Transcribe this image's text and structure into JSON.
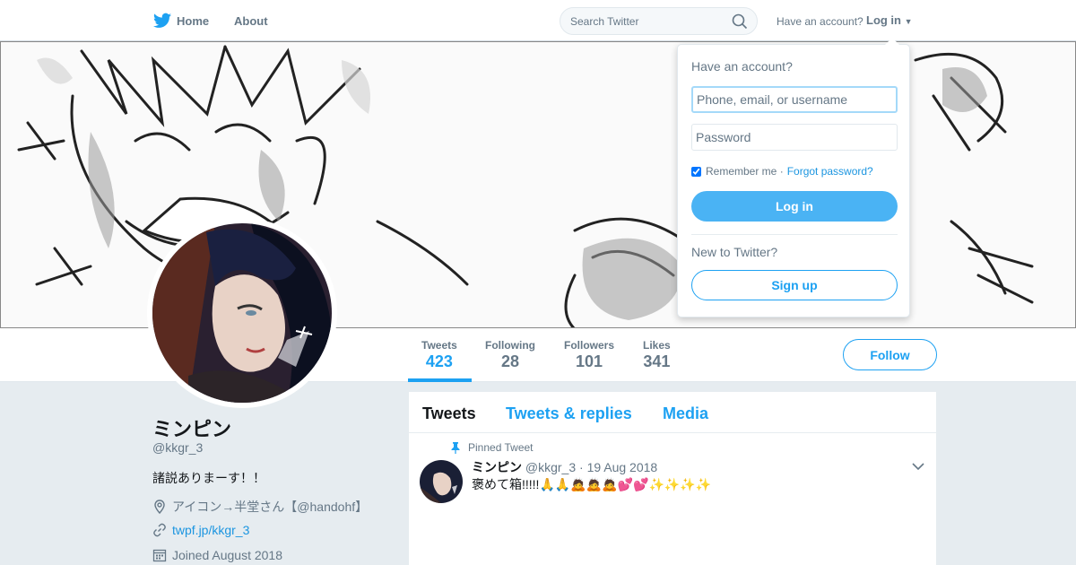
{
  "nav": {
    "home_label": "Home",
    "about_label": "About",
    "search_placeholder": "Search Twitter",
    "have_account": "Have an account?",
    "login_label": "Log in",
    "brand_color": "#1da1f2",
    "brand_icon": "twitter-bird-icon"
  },
  "profile": {
    "name": "ミンピン",
    "handle": "@kkgr_3",
    "bio": "諸説ありまーす！！",
    "location": "アイコン→半堂さん【@handohf】",
    "website": "twpf.jp/kkgr_3",
    "joined": "Joined August 2018",
    "follow_label": "Follow"
  },
  "stats": [
    {
      "label": "Tweets",
      "value": "423"
    },
    {
      "label": "Following",
      "value": "28"
    },
    {
      "label": "Followers",
      "value": "101"
    },
    {
      "label": "Likes",
      "value": "341"
    }
  ],
  "timeline": {
    "tabs": [
      "Tweets",
      "Tweets & replies",
      "Media"
    ],
    "pinned_label": "Pinned Tweet",
    "tweet": {
      "name": "ミンピン",
      "handle": "@kkgr_3",
      "date": "· 19 Aug 2018",
      "text": "褒めて箱!!!!!🙏🙏🙇🙇🙇💕💕✨✨✨✨"
    }
  },
  "login_dropdown": {
    "title": "Have an account?",
    "username_placeholder": "Phone, email, or username",
    "password_placeholder": "Password",
    "remember_label": "Remember me ·",
    "forgot_label": "Forgot password?",
    "login_button": "Log in",
    "new_label": "New to Twitter?",
    "signup_button": "Sign up"
  }
}
